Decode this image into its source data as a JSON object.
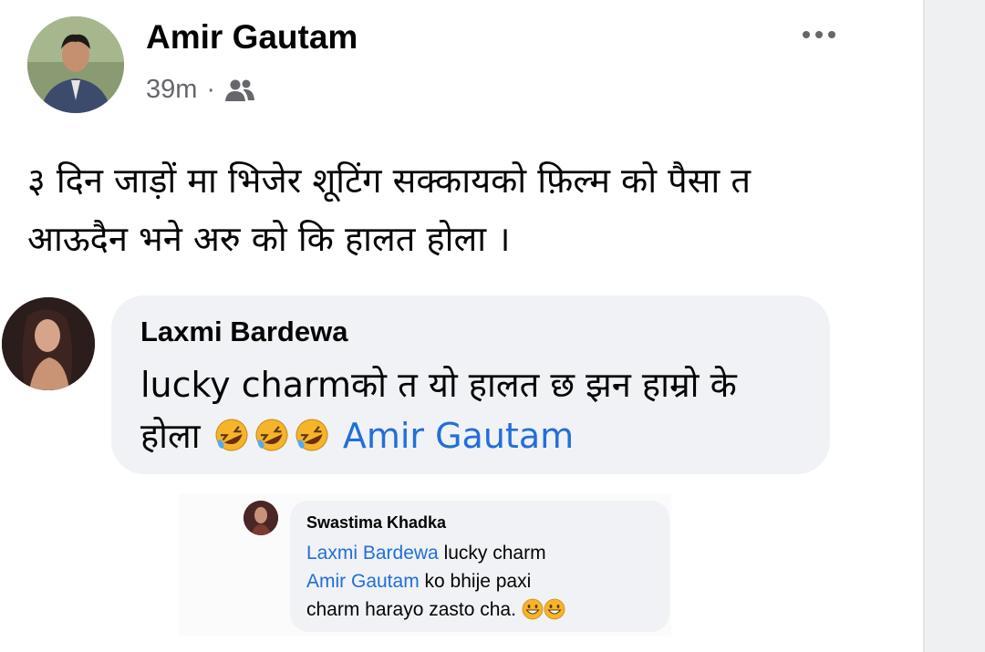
{
  "post": {
    "author": "Amir Gautam",
    "time": "39m",
    "separator": "·",
    "audience_icon": "friends-icon",
    "more_icon": "more-options-icon",
    "text_line1": "३ दिन जाड़ों मा भिजेर शूटिंग सक्कायको फ़िल्म को पैसा त",
    "text_line2": "आऊदैन भने अरु को कि हालत होला ।"
  },
  "comment": {
    "author": "Laxmi Bardewa",
    "text_line1": "lucky charmको त यो हालत छ झन हाम्रो के",
    "text_line2": "होला",
    "emoji": "rolling-laughing-emoji",
    "emoji_count": 3,
    "mention": "Amir Gautam"
  },
  "reply": {
    "author": "Swastima Khadka",
    "mention1": "Laxmi Bardewa",
    "text1": " lucky charm",
    "mention2": "Amir Gautam",
    "text2": " ko bhije paxi",
    "text3": "charm harayo zasto cha.",
    "emoji": "grinning-emoji",
    "emoji_count": 2
  },
  "colors": {
    "mention": "#216fdb",
    "bubble": "#f0f2f5",
    "meta": "#65676b",
    "emoji_face": "#f5b429"
  }
}
